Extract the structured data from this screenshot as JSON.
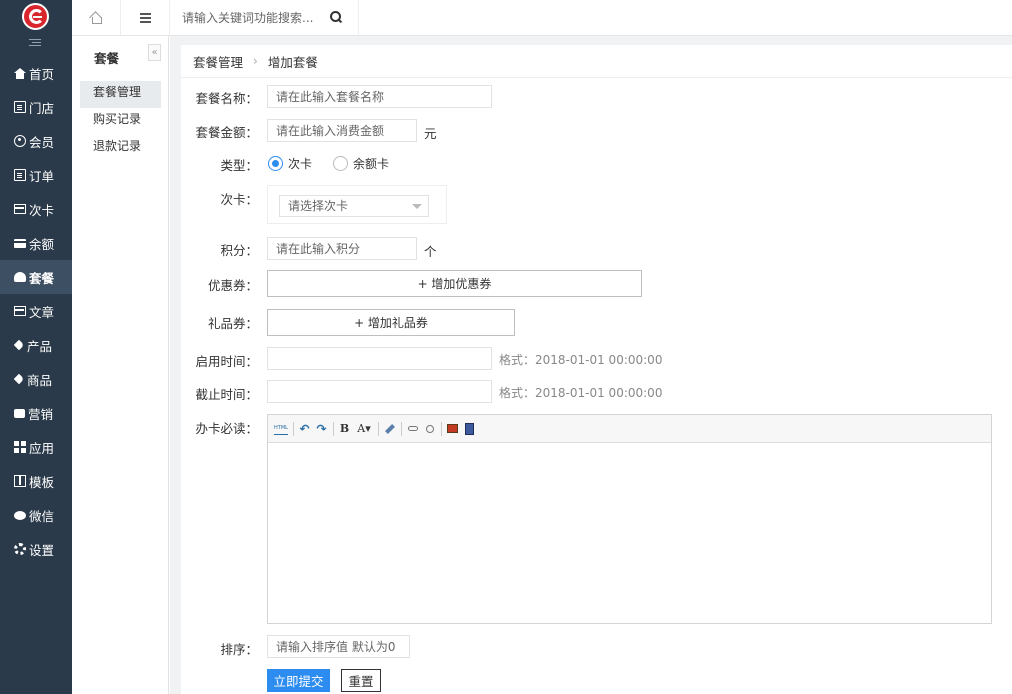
{
  "sidebar": {
    "items": [
      {
        "label": "首页",
        "icon": "home-icon"
      },
      {
        "label": "门店",
        "icon": "store-icon"
      },
      {
        "label": "会员",
        "icon": "user-circle-icon"
      },
      {
        "label": "订单",
        "icon": "order-icon"
      },
      {
        "label": "次卡",
        "icon": "card-icon"
      },
      {
        "label": "余额",
        "icon": "balance-card-icon"
      },
      {
        "label": "套餐",
        "icon": "dashboard-icon",
        "active": true
      },
      {
        "label": "文章",
        "icon": "article-icon"
      },
      {
        "label": "产品",
        "icon": "tag-icon"
      },
      {
        "label": "商品",
        "icon": "tag-icon"
      },
      {
        "label": "营销",
        "icon": "thumbs-up-icon"
      },
      {
        "label": "应用",
        "icon": "grid-icon"
      },
      {
        "label": "模板",
        "icon": "columns-icon"
      },
      {
        "label": "微信",
        "icon": "wechat-icon"
      },
      {
        "label": "设置",
        "icon": "gears-icon"
      }
    ]
  },
  "topbar": {
    "search_placeholder": "请输入关键词功能搜索..."
  },
  "subnav": {
    "title": "套餐",
    "collapse_glyph": "«",
    "items": [
      "套餐管理",
      "购买记录",
      "退款记录"
    ]
  },
  "breadcrumb": {
    "parent": "套餐管理",
    "separator": "›",
    "current": "增加套餐"
  },
  "form": {
    "name": {
      "label": "套餐名称：",
      "placeholder": "请在此输入套餐名称"
    },
    "amount": {
      "label": "套餐金额：",
      "placeholder": "请在此输入消费金额",
      "unit": "元"
    },
    "type": {
      "label": "类型：",
      "options": [
        "次卡",
        "余额卡"
      ],
      "selected": "次卡"
    },
    "card": {
      "label": "次卡：",
      "select_placeholder": "请选择次卡"
    },
    "points": {
      "label": "积分：",
      "placeholder": "请在此输入积分",
      "unit": "个"
    },
    "coupon": {
      "label": "优惠券：",
      "button": "+ 增加优惠券"
    },
    "gift": {
      "label": "礼品券：",
      "button": "+ 增加礼品券"
    },
    "start_time": {
      "label": "启用时间：",
      "hint": "格式：2018-01-01 00:00:00"
    },
    "end_time": {
      "label": "截止时间：",
      "hint": "格式：2018-01-01 00:00:00"
    },
    "notice": {
      "label": "办卡必读："
    },
    "sort": {
      "label": "排序：",
      "placeholder": "请输入排序值 默认为0"
    },
    "submit": "立即提交",
    "reset": "重置"
  },
  "colors": {
    "sidebar_bg": "#2b3a4a",
    "accent": "#2d8cf0",
    "logo": "#d9262c"
  }
}
